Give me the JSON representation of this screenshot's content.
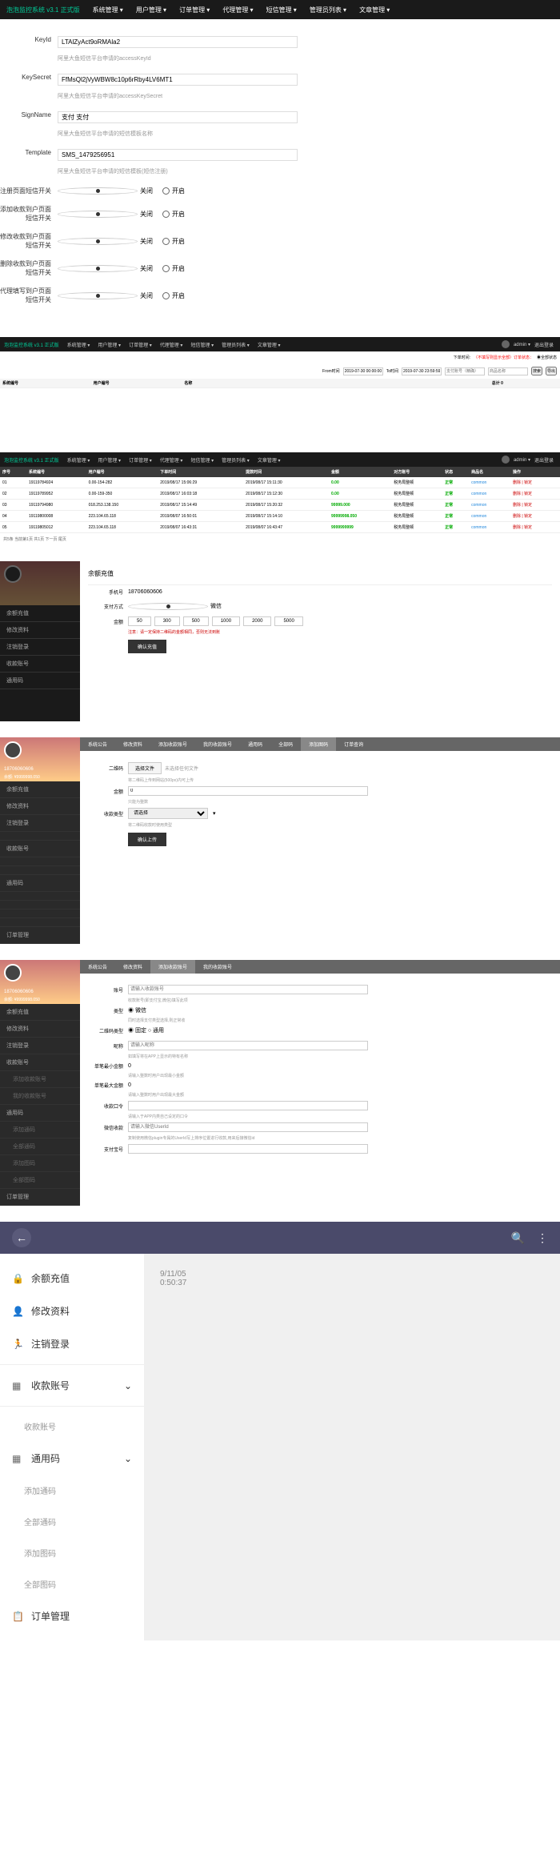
{
  "s1": {
    "brand": "泡泡监控系统 v3.1 正式版",
    "nav": [
      "系统管理 ▾",
      "用户管理 ▾",
      "订单管理 ▾",
      "代理管理 ▾",
      "短信管理 ▾",
      "管理员列表 ▾",
      "文章管理 ▾"
    ],
    "rows": [
      {
        "label": "KeyId",
        "val": "LTAlZyAct9oRMAla2",
        "hint": "阿里大鱼短信平台申请的accessKeyId"
      },
      {
        "label": "KeySecret",
        "val": "FfMsQl2jVyWBW8c10p6rRby4LV6MT1",
        "hint": "阿里大鱼短信平台申请的accessKeySecret"
      },
      {
        "label": "SignName",
        "val": "支付 支付",
        "hint": "阿里大鱼短信平台申请的短信模板名称"
      },
      {
        "label": "Template",
        "val": "SMS_1479256951",
        "hint": "阿里大鱼短信平台申请的短信模板(短信注册)"
      }
    ],
    "switches": [
      {
        "label": "注册页面短信开关"
      },
      {
        "label": "添加收款到户页面短信开关"
      },
      {
        "label": "修改收款到户页面短信开关"
      },
      {
        "label": "删除收款到户页面短信开关"
      },
      {
        "label": "代理填写到户页面短信开关"
      }
    ],
    "opt_close": "关闭",
    "opt_open": "开启"
  },
  "s2": {
    "nav": [
      "系统管理 ▾",
      "用户管理 ▾",
      "订单管理 ▾",
      "代理管理 ▾",
      "短信管理 ▾",
      "管理员列表 ▾",
      "文章管理 ▾"
    ],
    "admin": "admin ▾",
    "logout": "退出登录",
    "filter": {
      "label1": "下单时间:",
      "red": "（不填写则显示全部）订单状态：",
      "all": "◉全部状态",
      "from": "From时间",
      "f1": "2019-07-30 00:00:00",
      "to": "To时间",
      "f2": "2019-07-30 23:59:59",
      "f3": "支付账号（精确）",
      "f4": "商品名称",
      "btn1": "搜索",
      "btn2": "导出"
    },
    "th": [
      "系统编号",
      "用户编号",
      "名称",
      "",
      "",
      "",
      "",
      "",
      "",
      "",
      "",
      "",
      "",
      "",
      "",
      "总计 0"
    ]
  },
  "s3": {
    "th": [
      "序号",
      "系统编号",
      "用户编号",
      "下单时间",
      "提款时间",
      "金额",
      "对方账号",
      "状态",
      "商品名",
      "操作"
    ],
    "rows": [
      [
        "01",
        "19119784924",
        "0.00-154-282",
        "2019/08/17 15:06:29",
        "2019/08/17 15:11:30",
        "0.00",
        "税务局整顿",
        "正常",
        "common",
        "删除 | 锁定"
      ],
      [
        "02",
        "19119789952",
        "0.00-159-350",
        "2019/08/17 16:03:18",
        "2019/08/17 15:12:30",
        "0.00",
        "税务局整顿",
        "正常",
        "common",
        "删除 | 锁定"
      ],
      [
        "03",
        "19119794980",
        "018.253.138.150",
        "2019/08/17 15:14:49",
        "2019/08/17 15:20:32",
        "99999.000",
        "税务局整顿",
        "正常",
        "common",
        "删除 | 锁定"
      ],
      [
        "04",
        "19119800008",
        "223.104.65.118",
        "2019/08/07 16:50:01",
        "2019/08/17 15:14:10",
        "99999998.050",
        "税务局整顿",
        "正常",
        "common",
        "删除 | 锁定"
      ],
      [
        "05",
        "19119805012",
        "223.104.65.118",
        "2019/08/07 16:43:31",
        "2019/08/07 16:43:47",
        "9999999999",
        "税务局整顿",
        "正常",
        "common",
        "删除 | 锁定"
      ]
    ],
    "foot": "共5条 当前第1页 共1页 下一页 尾页"
  },
  "s4": {
    "title": "余额充值",
    "phone_lbl": "手机号",
    "phone": "18706060606",
    "pay_lbl": "支付方式",
    "pay_opt": "微信",
    "amt_lbl": "金额",
    "amts": [
      "50",
      "300",
      "500",
      "1000",
      "2000",
      "5000"
    ],
    "note": "注意：请一定保持二维码的金额相同，否则无法到账",
    "btn": "确认充值"
  },
  "s5": {
    "sb_name": "18706060606",
    "sb_bal": "余额: ¥9999998.050",
    "sb": [
      "余额充值",
      "修改资料",
      "注销登录",
      "",
      "收款账号",
      "",
      "",
      "通用码",
      "",
      "",
      "",
      "",
      "订单管理"
    ],
    "tabs": [
      "系统公告",
      "修改资料",
      "添加收款账号",
      "我的收款账号",
      "通用码",
      "全部码",
      "添加图码",
      "订单查询"
    ],
    "qr_lbl": "二维码",
    "file_btn": "选择文件",
    "file_hint": "未选择任何文件",
    "qr_note": "将二维码上传到网站(500px)内可上传",
    "amt_lbl": "金额",
    "amt_val": "0",
    "amt_hint": "只能为整数",
    "type_lbl": "收款类型",
    "type_val": "请选择",
    "type_hint": "将二维码收款时使用类型",
    "btn": "确认上传"
  },
  "s6": {
    "tabs": [
      "系统公告",
      "修改资料",
      "添加收款账号",
      "我的收款账号"
    ],
    "f": [
      {
        "l": "账号",
        "p": "请输入收款账号",
        "h": "收款账号(即支付宝,微信)填写此项"
      },
      {
        "l": "类型",
        "v": "◉ 微信",
        "h": "同时选择支付类型选择,则正常收"
      },
      {
        "l": "二维码类型",
        "v": "◉ 固定    ○ 通用"
      },
      {
        "l": "昵称",
        "p": "请输入昵称",
        "h": "如填写将在APP上显示的特有名称"
      },
      {
        "l": "单笔最小金额",
        "v": "0",
        "h": "请输入整数时用户出现最小金额"
      },
      {
        "l": "单笔最大金额",
        "v": "0",
        "h": "请输入整数时用户出现最大金额"
      },
      {
        "l": "收款口令",
        "p": "",
        "h": "请输入于APP内类自己设定的口令"
      },
      {
        "l": "微信收款",
        "p": "请输入微信UserId",
        "h": "复制使用微信plugin专属的UserId写上排序位置进行收款,用来后接微信id"
      },
      {
        "l": "支付宝号",
        "p": "",
        "h": ""
      }
    ]
  },
  "s7": {
    "items": [
      "余额充值",
      "修改资料",
      "注销登录",
      "收款账号",
      "",
      "收款账号",
      "通用码",
      "添加通码",
      "全部通码",
      "添加图码",
      "全部图码",
      "订单管理"
    ],
    "date": "9/11/05",
    "time": "0:50:37"
  }
}
